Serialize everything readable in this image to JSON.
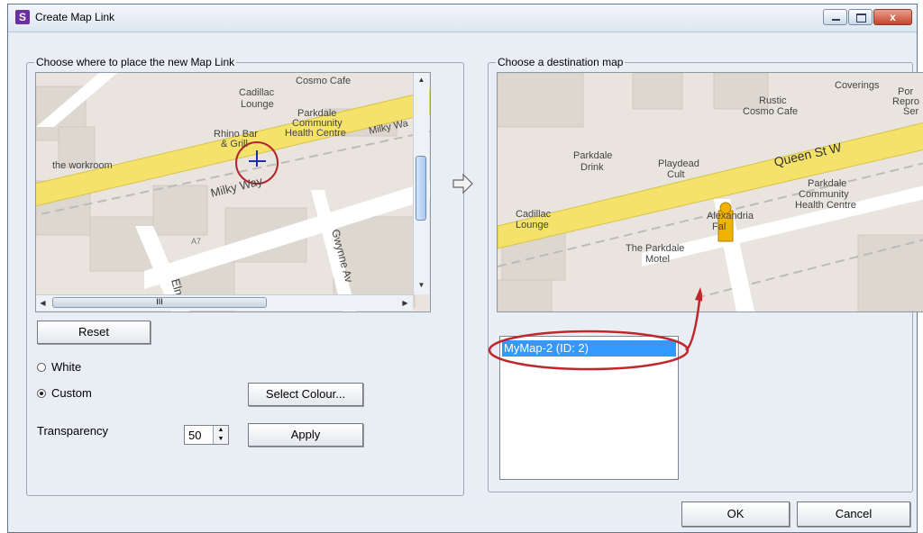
{
  "window": {
    "app_icon_letter": "S",
    "title": "Create Map Link",
    "close_glyph": "x"
  },
  "left_group": {
    "label": "Choose where to place the new Map Link",
    "map_labels": {
      "cadillac_lounge_1": "Cadillac",
      "cadillac_lounge_2": "Lounge",
      "cosmo_cafe": "Cosmo Cafe",
      "parkdale_1": "Parkdale",
      "parkdale_2": "Community",
      "parkdale_3": "Health Centre",
      "rhino_1": "Rhino Bar",
      "rhino_2": "& Grill",
      "milky_way_1": "Milky Wa",
      "milky_way_2": "Milky Way",
      "workroom": "the workroom",
      "elm": "Elm",
      "gwynne": "Gwynne Av",
      "a7": "A7"
    },
    "scrollbar_grip": "III",
    "reset_label": "Reset",
    "radio_white": "White",
    "radio_custom": "Custom",
    "select_colour_label": "Select Colour...",
    "transparency_label": "Transparency",
    "transparency_value": "50",
    "apply_label": "Apply"
  },
  "right_group": {
    "label": "Choose a destination map",
    "map_labels": {
      "coverings": "Coverings",
      "por": "Por",
      "repro": "Repro",
      "ser": "Ser",
      "rustic_1": "Rustic",
      "rustic_2": "Cosmo Cafe",
      "parkdale_drink_1": "Parkdale",
      "parkdale_drink_2": "Drink",
      "playdead_1": "Playdead",
      "playdead_2": "Cult",
      "queen_st": "Queen St W",
      "parkdale_1": "Parkdale",
      "parkdale_2": "Community",
      "parkdale_3": "Health Centre",
      "cadillac_1": "Cadillac",
      "cadillac_2": "Lounge",
      "alexandria_1": "Alexandria",
      "alexandria_2": "Fal",
      "motel_1": "The Parkdale",
      "motel_2": "Motel"
    },
    "list_items": [
      "MyMap-2 (ID: 2)"
    ]
  },
  "footer": {
    "ok_label": "OK",
    "cancel_label": "Cancel"
  },
  "colors": {
    "selection": "#3399ff",
    "annotation": "#c0272d",
    "road_major": "#f4e26a"
  }
}
